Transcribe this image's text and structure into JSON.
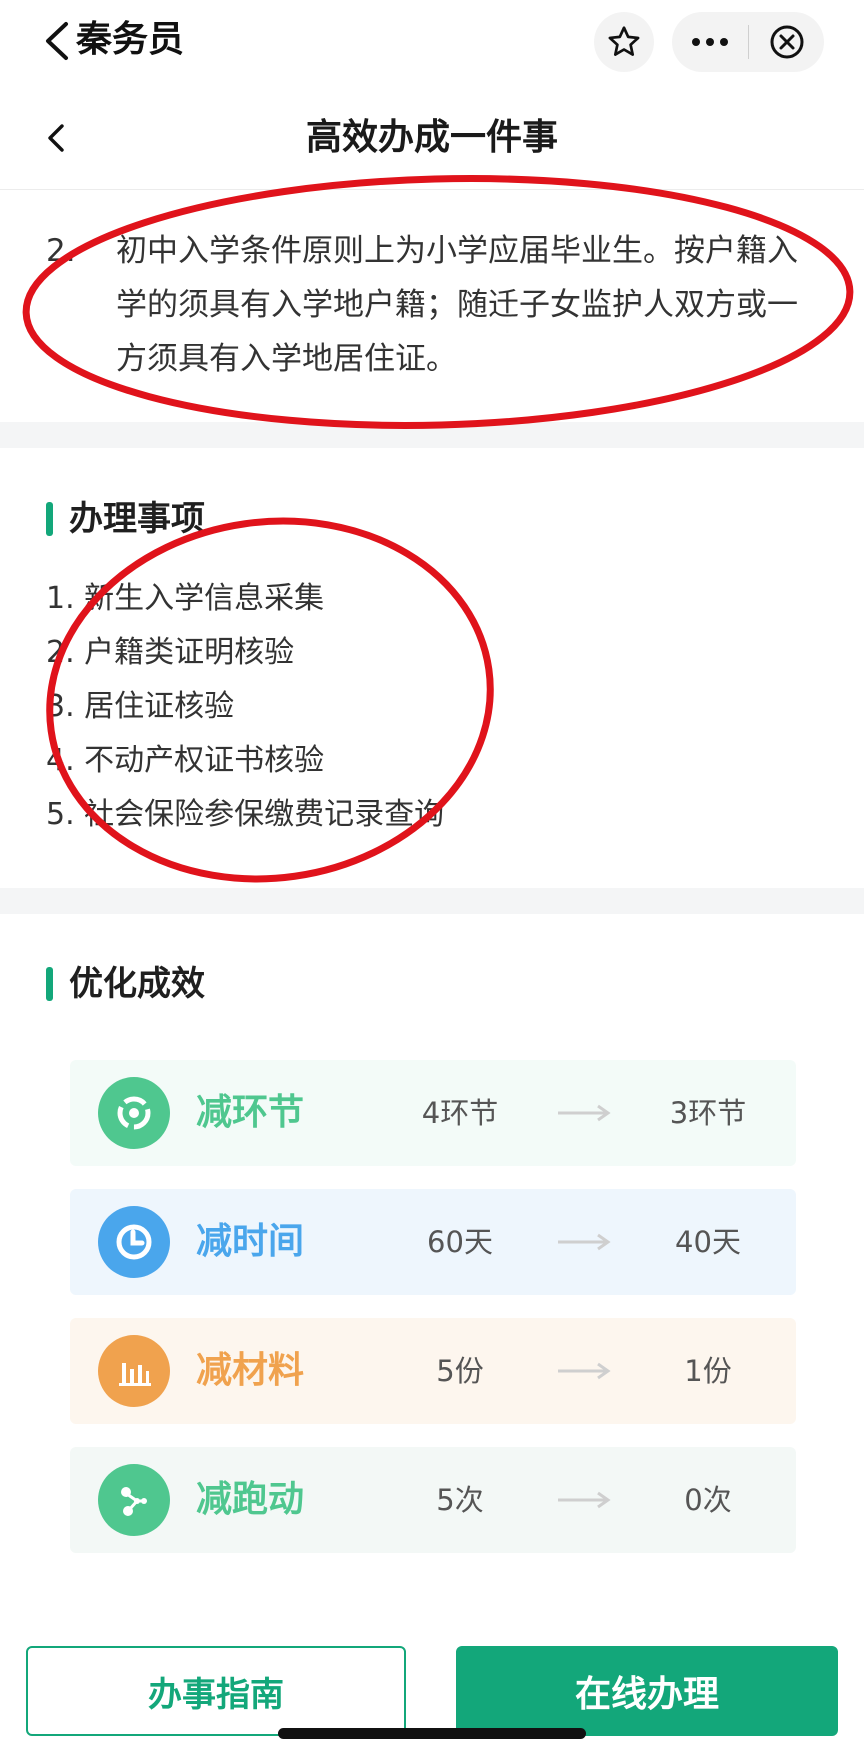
{
  "topbar": {
    "app_name": "秦务员",
    "icons": [
      "chevron-left-icon",
      "star-icon",
      "more-icon",
      "close-circle-icon"
    ]
  },
  "header": {
    "title": "高效办成一件事"
  },
  "condition": {
    "number": "2.",
    "text": "初中入学条件原则上为小学应届毕业生。按户籍入学的须具有入学地户籍；随迁子女监护人双方或一方须具有入学地居住证。"
  },
  "matters": {
    "title": "办理事项",
    "items": [
      "1. 新生入学信息采集",
      "2. 户籍类证明核验",
      "3. 居住证核验",
      "4. 不动产权证书核验",
      "5. 社会保险参保缴费记录查询"
    ]
  },
  "effects": {
    "title": "优化成效",
    "rows": [
      {
        "label": "减环节",
        "from": "4环节",
        "to": "3环节",
        "color": "#4fc78f",
        "bg": "#f3fbf8",
        "icon": "cycle-icon"
      },
      {
        "label": "减时间",
        "from": "60天",
        "to": "40天",
        "color": "#4aa6ec",
        "bg": "#eef6fd",
        "icon": "clock-icon"
      },
      {
        "label": "减材料",
        "from": "5份",
        "to": "1份",
        "color": "#f0a24e",
        "bg": "#fdf6ee",
        "icon": "bar-chart-icon"
      },
      {
        "label": "减跑动",
        "from": "5次",
        "to": "0次",
        "color": "#4fc78f",
        "bg": "#f3f8f6",
        "icon": "share-icon"
      }
    ]
  },
  "buttons": {
    "guide": "办事指南",
    "online": "在线办理"
  },
  "colors": {
    "accent": "#13a77a",
    "annotation": "#e0131b"
  }
}
